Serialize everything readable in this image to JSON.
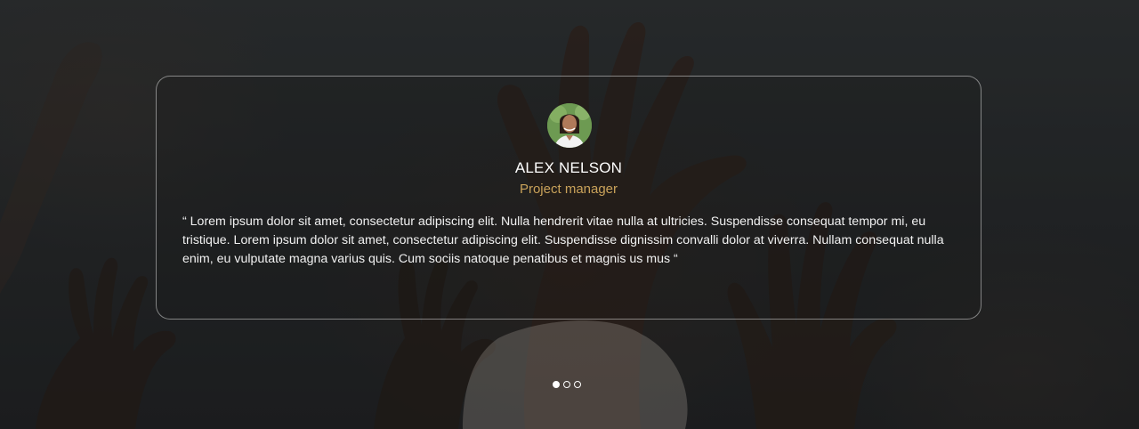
{
  "testimonial": {
    "name": "ALEX NELSON",
    "role": "Project manager",
    "quote": "“ Lorem ipsum dolor sit amet, consectetur adipiscing elit. Nulla hendrerit vitae nulla at ultricies. Suspendisse consequat tempor mi, eu tristique. Lorem ipsum dolor sit amet, consectetur adipiscing elit. Suspendisse dignissim convalli dolor at viverra. Nullam consequat nulla enim, eu vulputate magna varius quis. Cum sociis natoque penatibus et magnis us mus “",
    "avatar_icon": "person-avatar-icon"
  },
  "carousel": {
    "active_index": 0,
    "dots": [
      {
        "label": "Slide 1"
      },
      {
        "label": "Slide 2"
      },
      {
        "label": "Slide 3"
      }
    ]
  },
  "colors": {
    "role_accent": "#c9a25a",
    "card_border": "rgba(255,255,255,0.45)",
    "text": "#ffffff"
  }
}
